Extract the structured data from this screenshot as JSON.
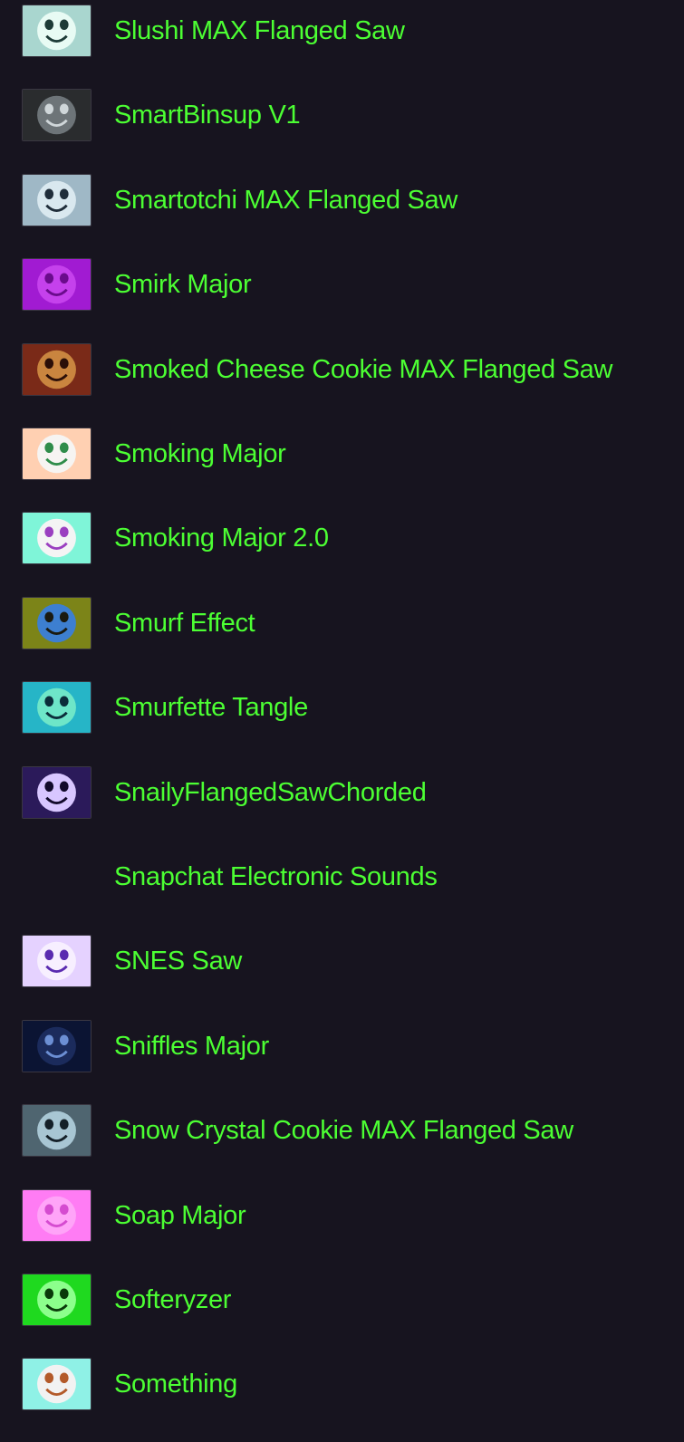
{
  "items": [
    {
      "label": "Slushi MAX Flanged Saw",
      "icon": "slushi-face-icon",
      "bg": "#a9d6cf",
      "face": "#e8fbf4",
      "feature": "#1d3b37",
      "has_thumb": true
    },
    {
      "label": "SmartBinsup V1",
      "icon": "smartbinsup-screen-icon",
      "bg": "#2a2c2e",
      "face": "#6d7478",
      "feature": "#cfd6d9",
      "has_thumb": true
    },
    {
      "label": "Smartotchi MAX Flanged Saw",
      "icon": "smartotchi-face-icon",
      "bg": "#9fb8c6",
      "face": "#d9e8ef",
      "feature": "#1f2d3a",
      "has_thumb": true
    },
    {
      "label": "Smirk Major",
      "icon": "smirk-face-icon",
      "bg": "#a11bd2",
      "face": "#c541ec",
      "feature": "#6a0b8c",
      "has_thumb": true
    },
    {
      "label": "Smoked Cheese Cookie MAX Flanged Saw",
      "icon": "smoked-cheese-cookie-face-icon",
      "bg": "#7a2a18",
      "face": "#c9853f",
      "feature": "#2b0f08",
      "has_thumb": true
    },
    {
      "label": "Smoking Major",
      "icon": "smoking-face-icon",
      "bg": "#ffd0b2",
      "face": "#f6f4f2",
      "feature": "#2f8c4a",
      "has_thumb": true
    },
    {
      "label": "Smoking Major 2.0",
      "icon": "smoking-2-face-icon",
      "bg": "#7ff5d8",
      "face": "#f4f4f4",
      "feature": "#9a3fc0",
      "has_thumb": true
    },
    {
      "label": "Smurf Effect",
      "icon": "smurf-face-icon",
      "bg": "#7c8418",
      "face": "#3d7fd0",
      "feature": "#1a1a10",
      "has_thumb": true
    },
    {
      "label": "Smurfette Tangle",
      "icon": "smurfette-face-icon",
      "bg": "#26b5c7",
      "face": "#6ee6c8",
      "feature": "#0b2d3a",
      "has_thumb": true
    },
    {
      "label": "SnailyFlangedSawChorded",
      "icon": "snaily-face-icon",
      "bg": "#2b1a5a",
      "face": "#d8c6ff",
      "feature": "#120a2a",
      "has_thumb": true
    },
    {
      "label": "Snapchat Electronic Sounds",
      "icon": "",
      "bg": "",
      "face": "",
      "feature": "",
      "has_thumb": false
    },
    {
      "label": "SNES Saw",
      "icon": "snes-face-icon",
      "bg": "#e5d2ff",
      "face": "#f7efff",
      "feature": "#5a2bb0",
      "has_thumb": true
    },
    {
      "label": "Sniffles Major",
      "icon": "sniffles-face-icon",
      "bg": "#0b1433",
      "face": "#1b2b5c",
      "feature": "#6c8fd4",
      "has_thumb": true
    },
    {
      "label": "Snow Crystal Cookie MAX Flanged Saw",
      "icon": "snow-crystal-cookie-face-icon",
      "bg": "#4f6570",
      "face": "#a8c6d3",
      "feature": "#142028",
      "has_thumb": true
    },
    {
      "label": "Soap Major",
      "icon": "soap-face-icon",
      "bg": "#ff7cf4",
      "face": "#ffa4f8",
      "feature": "#d54bd0",
      "has_thumb": true
    },
    {
      "label": "Softeryzer",
      "icon": "softeryzer-face-icon",
      "bg": "#1fd91f",
      "face": "#8cff8c",
      "feature": "#0a3b0a",
      "has_thumb": true
    },
    {
      "label": "Something",
      "icon": "something-face-icon",
      "bg": "#8ff1e6",
      "face": "#f2f2f2",
      "feature": "#b35a2a",
      "has_thumb": true
    }
  ]
}
